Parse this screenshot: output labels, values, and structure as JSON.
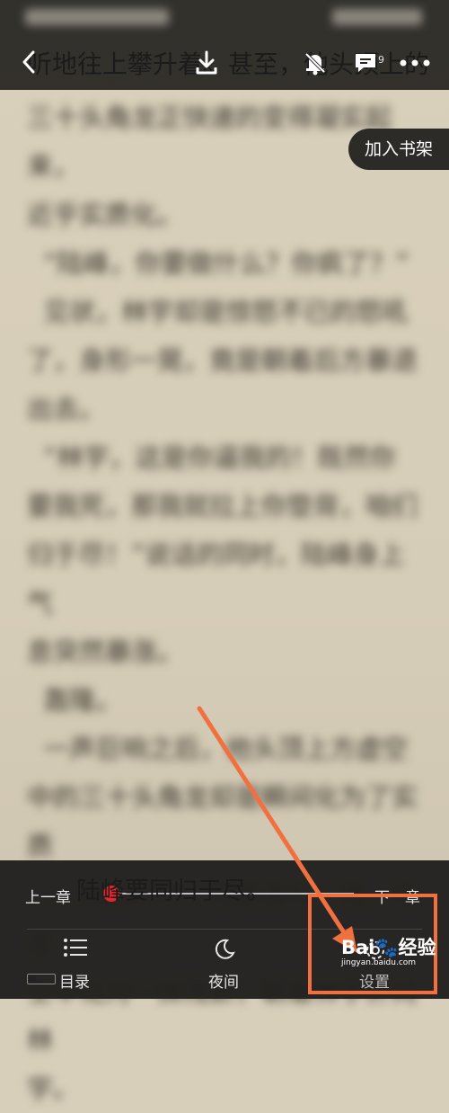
{
  "header": {
    "back_icon": "chevron-left-icon",
    "download_icon": "download-icon",
    "bell_icon": "bell-off-icon",
    "comment_icon": "comment-icon",
    "comment_count": "9",
    "more_icon": "more-icon"
  },
  "reader": {
    "visible_line_top": "听地往上攀升着。甚至，他头顶上的",
    "visible_line_bottom": "陆峰要同归于尽。",
    "add_to_shelf": "加入书架"
  },
  "bottom": {
    "prev_chapter": "上一章",
    "next_chapter": "下一章",
    "progress": 0.03,
    "nav": [
      {
        "label": "目录",
        "icon": "list-icon"
      },
      {
        "label": "夜间",
        "icon": "moon-icon"
      },
      {
        "label": "设置",
        "icon": "gear-icon"
      }
    ]
  },
  "watermark": {
    "brand": "Bai",
    "text": "经验",
    "url": "jingyan.baidu.com"
  },
  "colors": {
    "accent": "#e8242c",
    "annotation": "#f07040",
    "bar": "#22211f",
    "paper": "#d8cfbb"
  }
}
